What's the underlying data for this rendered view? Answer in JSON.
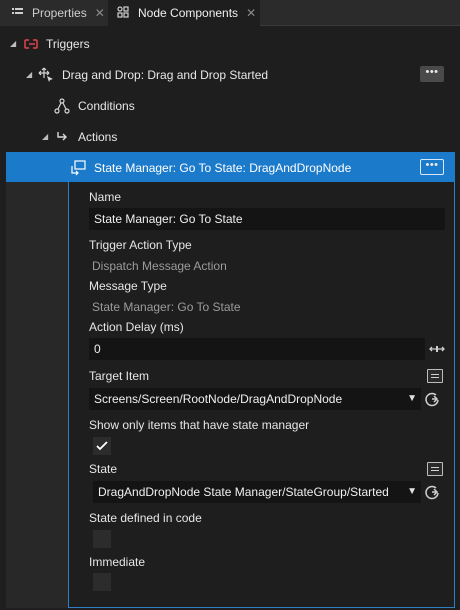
{
  "tabs": [
    {
      "label": "Properties",
      "icon": "list-icon"
    },
    {
      "label": "Node Components",
      "icon": "node-components-icon"
    }
  ],
  "tree": {
    "triggers": "Triggers",
    "trigger": "Drag and Drop: Drag and Drop Started",
    "conditions": "Conditions",
    "actions": "Actions",
    "action": "State Manager: Go To State: DragAndDropNode",
    "more": "•••"
  },
  "props": {
    "name_label": "Name",
    "name_value": "State Manager: Go To State",
    "trigger_action_type_label": "Trigger Action Type",
    "trigger_action_type_value": "Dispatch Message Action",
    "message_type_label": "Message Type",
    "message_type_value": "State Manager: Go To State",
    "action_delay_label": "Action Delay (ms)",
    "action_delay_value": "0",
    "target_item_label": "Target Item",
    "target_item_value": "Screens/Screen/RootNode/DragAndDropNode",
    "show_only_label": "Show only items that have state manager",
    "show_only_checked": true,
    "state_label": "State",
    "state_value": "DragAndDropNode State Manager/StateGroup/Started",
    "state_defined_label": "State defined in code",
    "state_defined_checked": false,
    "immediate_label": "Immediate",
    "immediate_checked": false
  },
  "colors": {
    "selection": "#1c7acb",
    "background": "#1e1e1e",
    "trigger_icon": "#e0454f"
  }
}
